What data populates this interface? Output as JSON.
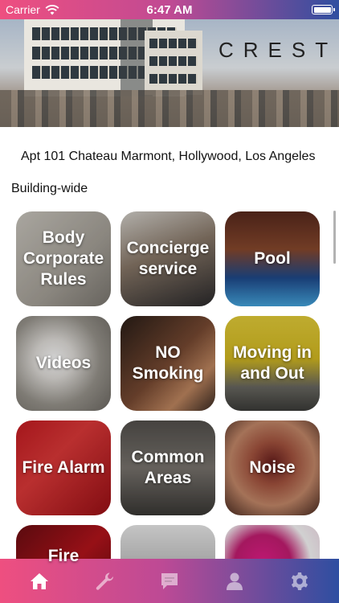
{
  "status_bar": {
    "carrier": "Carrier",
    "time": "6:47 AM"
  },
  "hero": {
    "title": "CREST"
  },
  "address": "Apt 101 Chateau Marmont, Hollywood, Los Angeles",
  "section_label": "Building-wide",
  "tiles": [
    {
      "label": "Body Corporate Rules",
      "image": "paper-documents-photo"
    },
    {
      "label": "Concierge service",
      "image": "concierge-woman-photo"
    },
    {
      "label": "Pool",
      "image": "rooftop-pool-photo"
    },
    {
      "label": "Videos",
      "image": "security-camera-photo"
    },
    {
      "label": "NO Smoking",
      "image": "smoker-photo"
    },
    {
      "label": "Moving in and Out",
      "image": "moving-truck-photo"
    },
    {
      "label": "Fire Alarm",
      "image": "fire-alarm-photo"
    },
    {
      "label": "Common Areas",
      "image": "lounge-photo"
    },
    {
      "label": "Noise",
      "image": "screaming-face-photo"
    },
    {
      "label": "Fire",
      "image": "fire-photo"
    },
    {
      "label": "",
      "image": "smiling-man-photo"
    },
    {
      "label": "",
      "image": "pink-burst-photo"
    }
  ],
  "tab_bar": [
    {
      "icon": "home-icon",
      "active": true
    },
    {
      "icon": "wrench-icon",
      "active": false
    },
    {
      "icon": "chat-icon",
      "active": false
    },
    {
      "icon": "user-icon",
      "active": false
    },
    {
      "icon": "gear-icon",
      "active": false
    }
  ],
  "colors": {
    "accent_pink": "#ee4f80",
    "accent_blue": "#2e4ea1"
  }
}
